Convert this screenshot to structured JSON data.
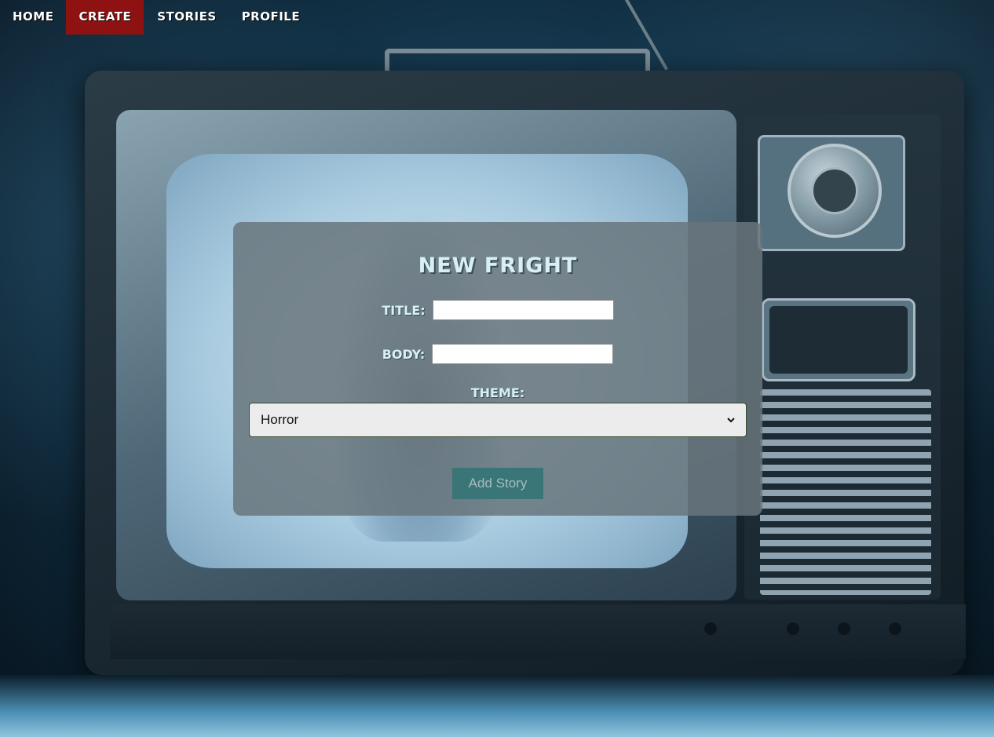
{
  "nav": {
    "items": [
      {
        "label": "Home",
        "active": false
      },
      {
        "label": "Create",
        "active": true
      },
      {
        "label": "Stories",
        "active": false
      },
      {
        "label": "Profile",
        "active": false
      }
    ],
    "active_color": "#8e1212"
  },
  "form": {
    "title": "New Fright",
    "title_label": "Title:",
    "title_value": "",
    "body_label": "Body:",
    "body_value": "",
    "theme_label": "Theme:",
    "theme_selected": "Horror",
    "submit_label": "Add Story"
  },
  "colors": {
    "card_bg": "#697680",
    "heading_text": "#d6f0f5",
    "button_bg": "#3a7577"
  }
}
